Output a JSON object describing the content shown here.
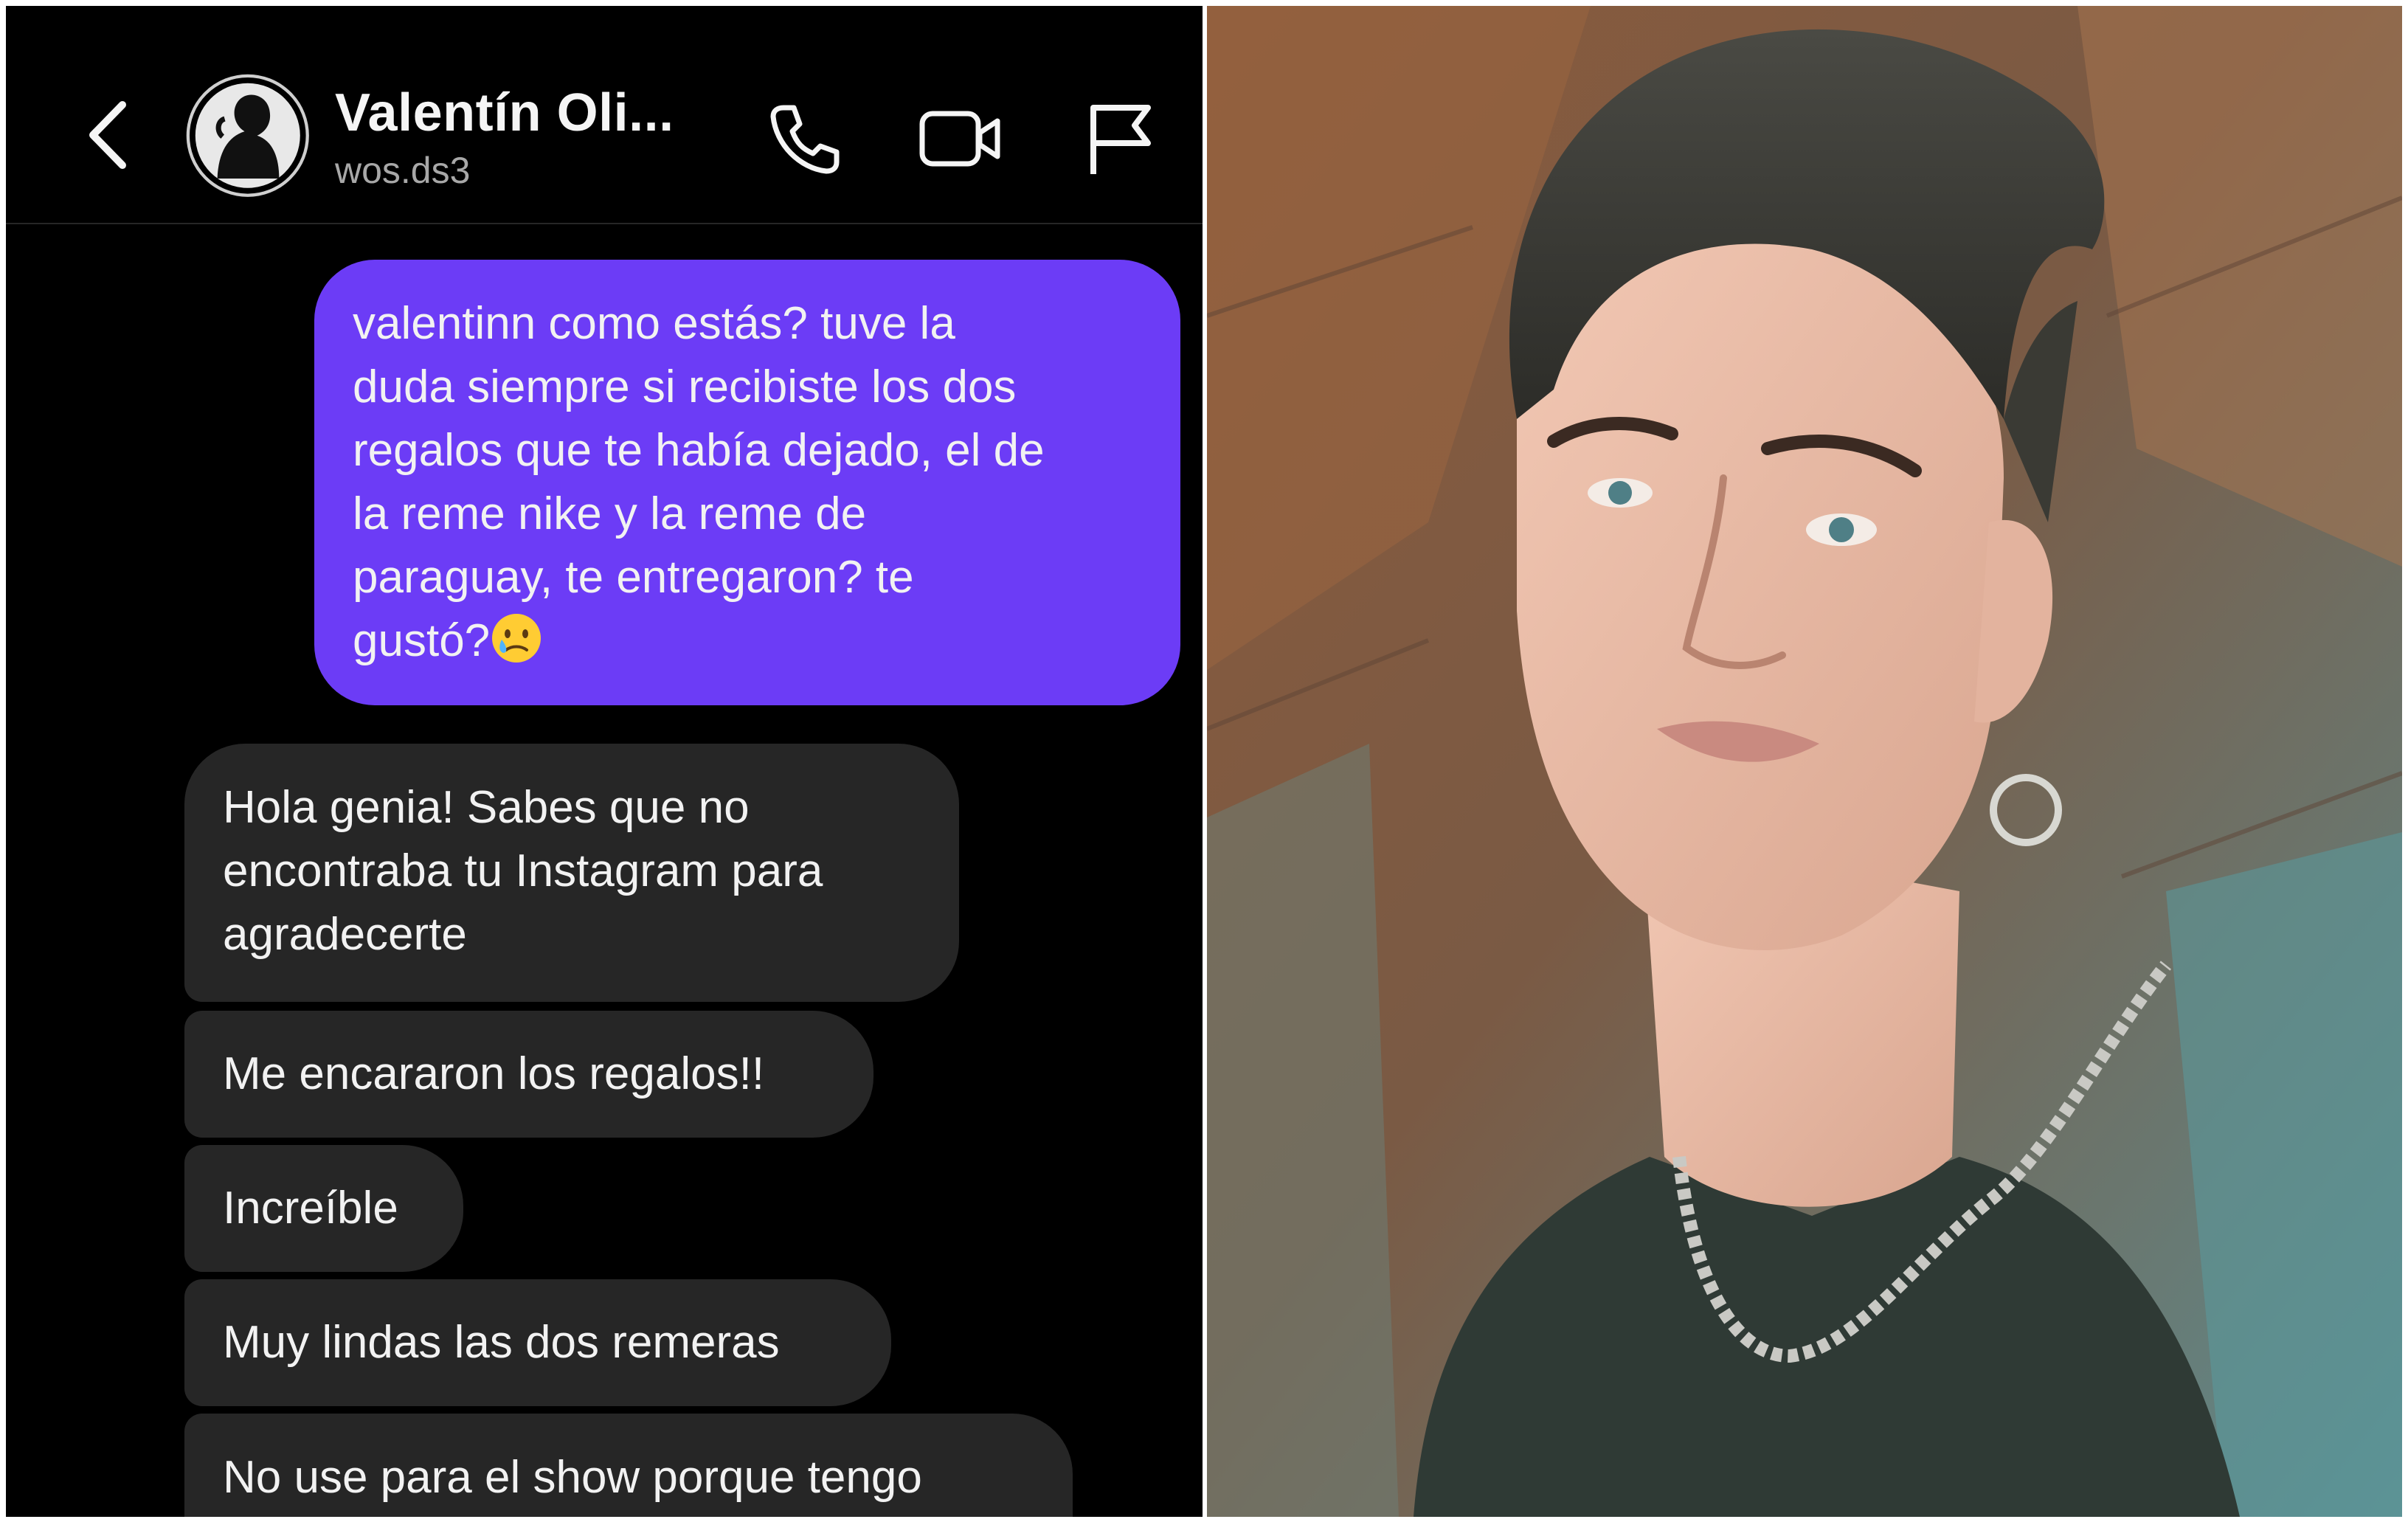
{
  "header": {
    "contact_name": "Valentín Oli...",
    "contact_handle": "wos.ds3",
    "icons": [
      "back-chevron-icon",
      "avatar",
      "phone-icon",
      "video-camera-icon",
      "flag-icon"
    ]
  },
  "colors": {
    "background": "#000000",
    "outgoing_bubble": "#6c3cf6",
    "incoming_bubble": "#262626",
    "text": "#f2f2f2",
    "handle_text": "#a8a8a8"
  },
  "messages": {
    "outgoing": [
      {
        "lines": [
          "valentinn como estás? tuve la",
          "duda siempre si recibiste los dos",
          "regalos que te había dejado, el de",
          "la reme nike y la reme de",
          "paraguay, te entregaron? te",
          "gustó?"
        ],
        "emoji": "face-holding-back-tears"
      }
    ],
    "incoming": [
      {
        "lines": [
          "Hola genia! Sabes que no",
          "encontraba tu Instagram para",
          "agradecerte"
        ]
      },
      {
        "lines": [
          "Me encararon los regalos!!"
        ]
      },
      {
        "lines": [
          "Increíble"
        ]
      },
      {
        "lines": [
          "Muy lindas las dos remeras"
        ]
      },
      {
        "lines": [
          "No use para el show porque tengo"
        ]
      }
    ]
  },
  "photo": {
    "subject": "portrait-photo",
    "description_icons": [
      "hoop-earring",
      "chain-necklace"
    ]
  }
}
